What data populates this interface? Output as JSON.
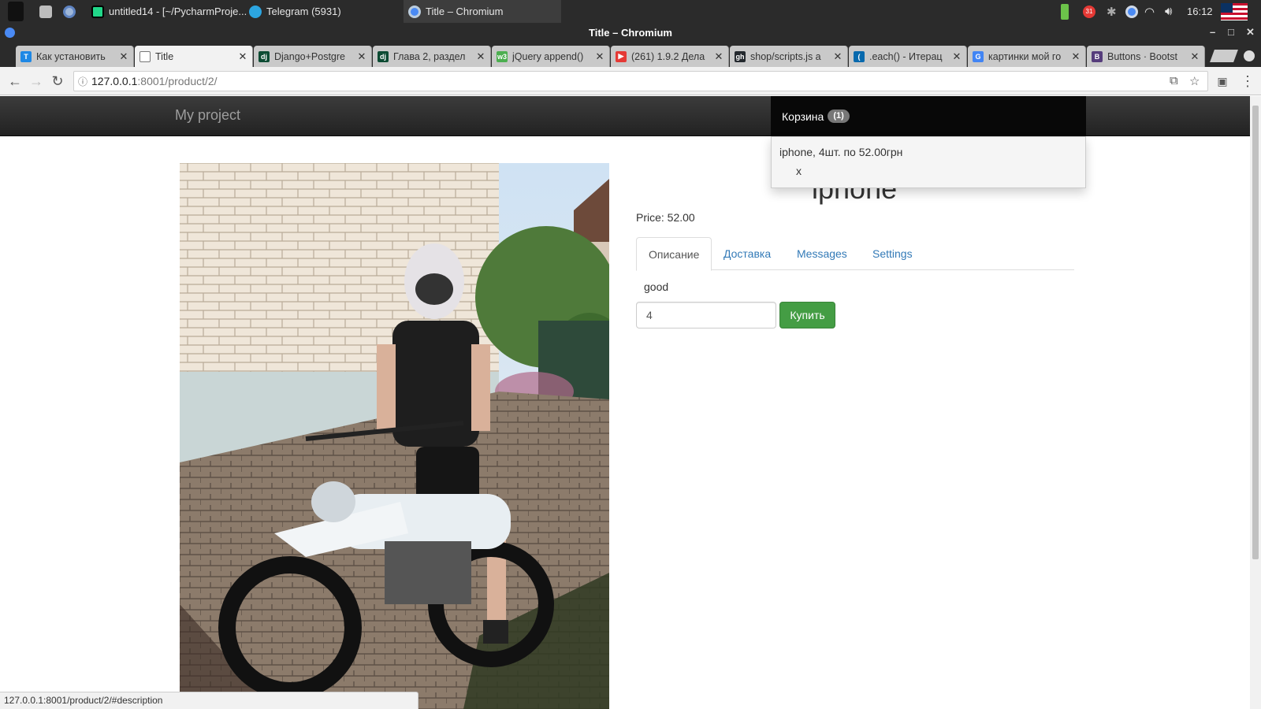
{
  "taskbar": {
    "items": [
      {
        "label": "untitled14 - [~/PycharmProje...",
        "icon": "pycharm-icon"
      },
      {
        "label": "Telegram (5931)",
        "icon": "telegram-icon"
      },
      {
        "label": "Title – Chromium",
        "icon": "chromium-icon"
      }
    ],
    "clock": "16:12",
    "tray_badge": "31",
    "keyboard_layout": "us-flag-icon"
  },
  "window": {
    "title": "Title – Chromium"
  },
  "tabs": [
    {
      "title": "Как установить",
      "favicon": "T",
      "color": "#1e88e5",
      "active": false
    },
    {
      "title": "Title",
      "favicon": "",
      "color": "#999999",
      "active": true
    },
    {
      "title": "Django+Postgre",
      "favicon": "dj",
      "color": "#0c4b33",
      "active": false
    },
    {
      "title": "Глава 2, раздел",
      "favicon": "dj",
      "color": "#0c4b33",
      "active": false
    },
    {
      "title": "jQuery append()",
      "favicon": "w3",
      "color": "#4caf50",
      "active": false
    },
    {
      "title": "(261) 1.9.2 Дела",
      "favicon": "▶",
      "color": "#e53935",
      "active": false
    },
    {
      "title": "shop/scripts.js a",
      "favicon": "gh",
      "color": "#24292e",
      "active": false
    },
    {
      "title": ".each() - Итерац",
      "favicon": "(",
      "color": "#0769ad",
      "active": false
    },
    {
      "title": "картинки мой го",
      "favicon": "G",
      "color": "#4285f4",
      "active": false
    },
    {
      "title": "Buttons · Bootst",
      "favicon": "B",
      "color": "#563d7c",
      "active": false
    }
  ],
  "omnibox": {
    "host": "127.0.0.1",
    "path": ":8001/product/2/"
  },
  "site": {
    "brand": "My project",
    "cart": {
      "label": "Корзина",
      "count": "(1)",
      "items": [
        {
          "text": "iphone, 4шт. по 52.00грн",
          "remove": "x"
        }
      ]
    }
  },
  "product": {
    "title": "iphone",
    "price": "Price: 52.00",
    "tabs": [
      "Описание",
      "Доставка",
      "Messages",
      "Settings"
    ],
    "active_tab": 0,
    "description": "good",
    "quantity": "4",
    "buy_label": "Купить"
  },
  "statusbar": {
    "url": "127.0.0.1:8001/product/2/#description"
  },
  "colors": {
    "buy_green": "#449d44",
    "link_blue": "#337ab7",
    "navbar_dark": "#222222"
  }
}
